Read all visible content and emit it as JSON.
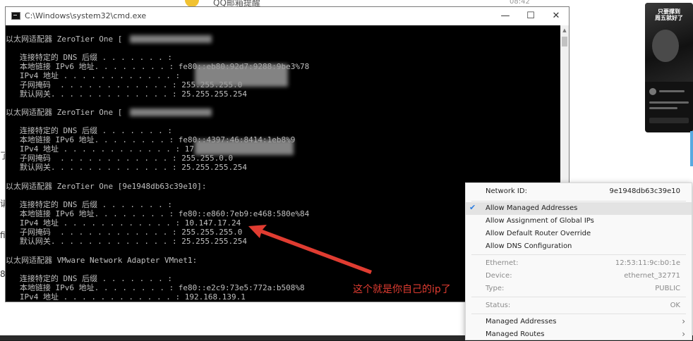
{
  "cmd": {
    "title": "C:\\Windows\\system32\\cmd.exe",
    "lines": [
      "以太网适配器 ZeroTier One [",
      "",
      "   连接特定的 DNS 后缀 . . . . . . . :",
      "   本地链接 IPv6 地址. . . . . . . . : fe80::eb80:92d7:9288:9be3%78",
      "   IPv4 地址 . . . . . . . . . . . . :",
      "   子网掩码  . . . . . . . . . . . . : 255.255.255.0",
      "   默认网关. . . . . . . . . . . . . : 25.255.255.254",
      "",
      "以太网适配器 ZeroTier One [",
      "",
      "   连接特定的 DNS 后缀 . . . . . . . :",
      "   本地链接 IPv6 地址. . . . . . . . : fe80::4397:46:8414:1eb8%9",
      "   IPv4 地址 . . . . . . . . . . . . : 17",
      "   子网掩码  . . . . . . . . . . . . : 255.255.0.0",
      "   默认网关. . . . . . . . . . . . . : 25.255.255.254",
      "",
      "以太网适配器 ZeroTier One [9e1948db63c39e10]:",
      "",
      "   连接特定的 DNS 后缀 . . . . . . . :",
      "   本地链接 IPv6 地址. . . . . . . . : fe80::e860:7eb9:e468:580e%84",
      "   IPv4 地址 . . . . . . . . . . . . : 10.147.17.24",
      "   子网掩码  . . . . . . . . . . . . : 255.255.255.0",
      "   默认网关. . . . . . . . . . . . . : 25.255.255.254",
      "",
      "以太网适配器 VMware Network Adapter VMnet1:",
      "",
      "   连接特定的 DNS 后缀 . . . . . . . :",
      "   本地链接 IPv6 地址. . . . . . . . : fe80::e2c9:73e5:772a:b508%8",
      "   IPv4 地址 . . . . . . . . . . . . : 192.168.139.1"
    ],
    "window_buttons": {
      "minimize": "—",
      "maximize": "☐",
      "close": "✕"
    }
  },
  "annotation": {
    "text": "这个就是你自己的ip了",
    "color": "#e03c31"
  },
  "menu": {
    "network_id_label": "Network ID:",
    "network_id_value": "9e1948db63c39e10",
    "allow_managed": "Allow Managed Addresses",
    "allow_global": "Allow Assignment of Global IPs",
    "allow_default_route": "Allow Default Router Override",
    "allow_dns": "Allow DNS Configuration",
    "ethernet_label": "Ethernet:",
    "ethernet_value": "12:53:11:9c:b0:1e",
    "device_label": "Device:",
    "device_value": "ethernet_32771",
    "type_label": "Type:",
    "type_value": "PUBLIC",
    "status_label": "Status:",
    "status_value": "OK",
    "managed_addresses": "Managed Addresses",
    "managed_routes": "Managed Routes"
  },
  "background": {
    "title_fragment": "QQ邮箱提醒",
    "time": "08:42",
    "phone_title": "只要撑到\n周五就好了",
    "left_glyphs": [
      "请",
      "fi",
      "8",
      "了"
    ]
  }
}
